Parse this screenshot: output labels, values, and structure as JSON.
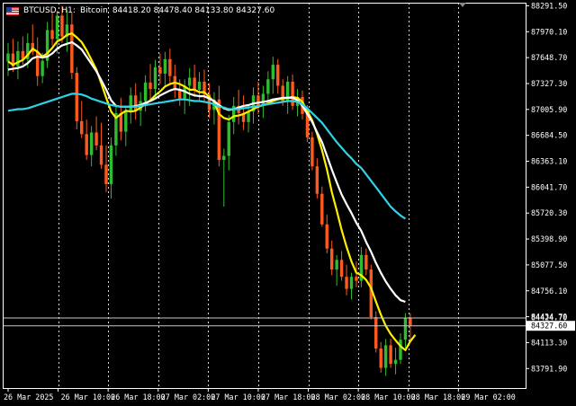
{
  "header": {
    "symbol": "BTCUSD",
    "timeframe": "H1",
    "description": "Bitcoin",
    "ohlc": "84418.20 84478.40 84133.80 84327.60"
  },
  "colors": {
    "background": "#000000",
    "bull": "#2ebd2e",
    "bear": "#ff5a1e",
    "ma_fast": "#ffee00",
    "ma_mid": "#ffffff",
    "ma_slow": "#2ed3e6",
    "grid": "#ffffff",
    "text": "#ffffff"
  },
  "price_labels": {
    "ask": "84424.70",
    "bid": "84327.60"
  },
  "chart_data": {
    "type": "candlestick",
    "title": "",
    "y_ticks": [
      "88291.50",
      "87970.10",
      "87648.70",
      "87327.30",
      "87005.90",
      "86684.50",
      "86363.10",
      "86041.70",
      "85720.30",
      "85398.90",
      "85077.50",
      "84756.10",
      "84434.70",
      "84113.30",
      "83791.90"
    ],
    "x_ticks": [
      "26 Mar 2025",
      "26 Mar 10:00",
      "26 Mar 18:00",
      "27 Mar 02:00",
      "27 Mar 10:00",
      "27 Mar 18:00",
      "28 Mar 02:00",
      "28 Mar 10:00",
      "28 Mar 18:00",
      "29 Mar 02:00"
    ],
    "ylim": [
      83550,
      88330
    ],
    "grid": true,
    "ask": 84424.7,
    "bid": 84327.6,
    "candles": [
      [
        87600,
        87830,
        87420,
        87700
      ],
      [
        87700,
        87880,
        87470,
        87540
      ],
      [
        87540,
        87850,
        87380,
        87730
      ],
      [
        87730,
        87910,
        87560,
        87630
      ],
      [
        87630,
        87950,
        87520,
        87830
      ],
      [
        87830,
        88060,
        87680,
        87720
      ],
      [
        87720,
        87900,
        87300,
        87420
      ],
      [
        87420,
        87710,
        87330,
        87610
      ],
      [
        87610,
        88090,
        87520,
        87990
      ],
      [
        87990,
        88210,
        87800,
        87880
      ],
      [
        87880,
        88230,
        87700,
        88170
      ],
      [
        88170,
        88290,
        87830,
        87910
      ],
      [
        87910,
        88240,
        87720,
        88060
      ],
      [
        88060,
        88210,
        87380,
        87460
      ],
      [
        87460,
        87530,
        86760,
        86860
      ],
      [
        86860,
        87110,
        86650,
        86700
      ],
      [
        86700,
        86880,
        86380,
        86440
      ],
      [
        86440,
        86800,
        86300,
        86720
      ],
      [
        86720,
        86920,
        86500,
        86560
      ],
      [
        86560,
        86840,
        86270,
        86320
      ],
      [
        86320,
        86560,
        85980,
        86080
      ],
      [
        86080,
        86660,
        85900,
        86560
      ],
      [
        86560,
        87060,
        86430,
        86960
      ],
      [
        86960,
        87150,
        86620,
        86730
      ],
      [
        86730,
        87050,
        86550,
        86980
      ],
      [
        86980,
        87280,
        86830,
        87180
      ],
      [
        87180,
        87330,
        86880,
        86990
      ],
      [
        86990,
        87220,
        86800,
        87110
      ],
      [
        87110,
        87430,
        86980,
        87340
      ],
      [
        87340,
        87570,
        87100,
        87260
      ],
      [
        87260,
        87620,
        87150,
        87530
      ],
      [
        87530,
        87700,
        87320,
        87450
      ],
      [
        87450,
        87720,
        87280,
        87630
      ],
      [
        87630,
        87760,
        87320,
        87420
      ],
      [
        87420,
        87560,
        87150,
        87250
      ],
      [
        87250,
        87380,
        87050,
        87140
      ],
      [
        87140,
        87380,
        86950,
        87300
      ],
      [
        87300,
        87520,
        87050,
        87400
      ],
      [
        87400,
        87560,
        87160,
        87250
      ],
      [
        87250,
        87470,
        87100,
        87350
      ],
      [
        87350,
        87500,
        87100,
        87190
      ],
      [
        87190,
        87330,
        86900,
        87000
      ],
      [
        87000,
        87220,
        86820,
        87130
      ],
      [
        87130,
        87300,
        86300,
        86380
      ],
      [
        86380,
        86520,
        85800,
        86430
      ],
      [
        86430,
        86940,
        86250,
        86850
      ],
      [
        86850,
        87160,
        86700,
        87050
      ],
      [
        87050,
        87250,
        86820,
        86960
      ],
      [
        86960,
        87180,
        86750,
        86850
      ],
      [
        86850,
        87070,
        86720,
        86980
      ],
      [
        86980,
        87280,
        86830,
        87180
      ],
      [
        87180,
        87350,
        86950,
        87050
      ],
      [
        87050,
        87300,
        86900,
        87200
      ],
      [
        87200,
        87480,
        87080,
        87380
      ],
      [
        87380,
        87660,
        87200,
        87560
      ],
      [
        87560,
        87630,
        87200,
        87300
      ],
      [
        87300,
        87380,
        87050,
        87100
      ],
      [
        87100,
        87420,
        86950,
        87350
      ],
      [
        87350,
        87440,
        87000,
        87050
      ],
      [
        87050,
        87260,
        86920,
        87160
      ],
      [
        87160,
        87240,
        86880,
        86950
      ],
      [
        86950,
        87060,
        86600,
        86660
      ],
      [
        86660,
        86730,
        86250,
        86300
      ],
      [
        86300,
        86400,
        85900,
        85960
      ],
      [
        85960,
        86050,
        85550,
        85580
      ],
      [
        85580,
        85700,
        85220,
        85280
      ],
      [
        85280,
        85380,
        84950,
        85020
      ],
      [
        85020,
        85200,
        84820,
        85140
      ],
      [
        85140,
        85250,
        84880,
        84930
      ],
      [
        84930,
        85080,
        84700,
        84780
      ],
      [
        84780,
        84980,
        84650,
        84930
      ],
      [
        84930,
        85120,
        84800,
        84880
      ],
      [
        84880,
        85300,
        84800,
        85200
      ],
      [
        85200,
        85280,
        84950,
        85020
      ],
      [
        85020,
        85080,
        84400,
        84430
      ],
      [
        84430,
        84500,
        83990,
        84040
      ],
      [
        84040,
        84120,
        83740,
        83800
      ],
      [
        83800,
        84160,
        83700,
        84080
      ],
      [
        84080,
        84160,
        83800,
        83850
      ],
      [
        83850,
        84050,
        83720,
        83900
      ],
      [
        83900,
        84230,
        83850,
        84150
      ],
      [
        84150,
        84480,
        84050,
        84420
      ],
      [
        84420,
        84478,
        84134,
        84328
      ]
    ],
    "series": [
      {
        "name": "",
        "color": "#ffee00",
        "values": [
          87600,
          87560,
          87590,
          87620,
          87680,
          87760,
          87720,
          87660,
          87700,
          87770,
          87850,
          87880,
          87930,
          87950,
          87900,
          87840,
          87740,
          87620,
          87500,
          87330,
          87150,
          86980,
          86900,
          86950,
          86990,
          86980,
          86990,
          87030,
          87070,
          87120,
          87180,
          87230,
          87290,
          87320,
          87340,
          87320,
          87290,
          87250,
          87250,
          87220,
          87220,
          87160,
          87100,
          86950,
          86900,
          86880,
          86920,
          86930,
          86950,
          86980,
          87010,
          87040,
          87060,
          87080,
          87110,
          87130,
          87140,
          87150,
          87160,
          87150,
          87100,
          86990,
          86870,
          86700,
          86500,
          86260,
          85980,
          85750,
          85510,
          85300,
          85120,
          84980,
          84950,
          84890,
          84790,
          84620,
          84460,
          84320,
          84220,
          84140,
          84070,
          84020,
          84130,
          84210
        ]
      },
      {
        "name": "",
        "color": "#ffffff",
        "values": [
          87500,
          87510,
          87520,
          87540,
          87580,
          87640,
          87660,
          87650,
          87660,
          87700,
          87760,
          87800,
          87820,
          87840,
          87800,
          87750,
          87660,
          87570,
          87480,
          87370,
          87250,
          87120,
          87050,
          87040,
          87040,
          87040,
          87050,
          87060,
          87090,
          87110,
          87140,
          87180,
          87210,
          87240,
          87260,
          87250,
          87230,
          87200,
          87180,
          87170,
          87170,
          87140,
          87110,
          87060,
          87020,
          87000,
          87010,
          87030,
          87050,
          87060,
          87080,
          87090,
          87100,
          87110,
          87130,
          87140,
          87150,
          87150,
          87150,
          87120,
          87050,
          86950,
          86850,
          86720,
          86600,
          86430,
          86260,
          86100,
          85950,
          85830,
          85720,
          85600,
          85500,
          85360,
          85240,
          85100,
          84980,
          84870,
          84780,
          84700,
          84640,
          84620
        ]
      },
      {
        "name": "",
        "color": "#2ed3e6",
        "values": [
          86990,
          87000,
          87010,
          87010,
          87020,
          87040,
          87060,
          87080,
          87100,
          87120,
          87140,
          87160,
          87180,
          87200,
          87200,
          87190,
          87170,
          87140,
          87120,
          87100,
          87080,
          87060,
          87050,
          87040,
          87040,
          87040,
          87040,
          87050,
          87060,
          87070,
          87080,
          87090,
          87100,
          87110,
          87120,
          87130,
          87130,
          87120,
          87110,
          87110,
          87100,
          87090,
          87070,
          87040,
          87030,
          87010,
          87010,
          87010,
          87020,
          87030,
          87040,
          87050,
          87060,
          87070,
          87080,
          87090,
          87100,
          87110,
          87110,
          87100,
          87070,
          87020,
          86960,
          86900,
          86840,
          86760,
          86680,
          86600,
          86530,
          86460,
          86400,
          86330,
          86280,
          86200,
          86120,
          86040,
          85960,
          85880,
          85800,
          85740,
          85690,
          85650
        ]
      }
    ]
  }
}
